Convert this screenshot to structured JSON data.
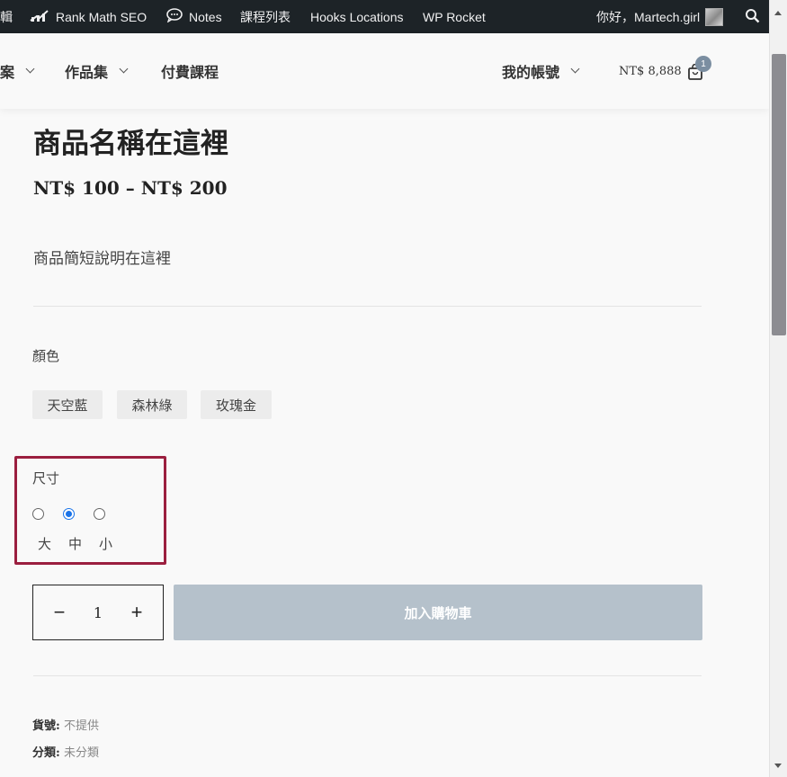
{
  "admin_bar": {
    "edit_partial": "輯",
    "rank_math": "Rank Math SEO",
    "notes": "Notes",
    "courses": "課程列表",
    "hooks": "Hooks Locations",
    "wp_rocket": "WP Rocket",
    "greeting": "你好，Martech.girl"
  },
  "header": {
    "nav": [
      {
        "label": "案"
      },
      {
        "label": "作品集"
      },
      {
        "label": "付費課程"
      }
    ],
    "account": "我的帳號",
    "cart_total": "NT$ 8,888",
    "cart_count": "1"
  },
  "product": {
    "title": "商品名稱在這裡",
    "price": "NT$ 100 – NT$ 200",
    "short_description": "商品簡短說明在這裡",
    "color_label": "顏色",
    "colors": [
      "天空藍",
      "森林綠",
      "玫瑰金"
    ],
    "size_label": "尺寸",
    "sizes": [
      {
        "label": "大",
        "checked": false
      },
      {
        "label": "中",
        "checked": true
      },
      {
        "label": "小",
        "checked": false
      }
    ],
    "quantity": "1",
    "minus": "−",
    "plus": "+",
    "add_to_cart": "加入購物車",
    "sku_label": "貨號:",
    "sku_value": "不提供",
    "category_label": "分類:",
    "category_value": "未分類"
  },
  "colors": {
    "admin_bg": "#1d2327",
    "highlight": "#9b1f3f",
    "button_disabled": "#b5c1cb",
    "radio_accent": "#1a73e8"
  }
}
